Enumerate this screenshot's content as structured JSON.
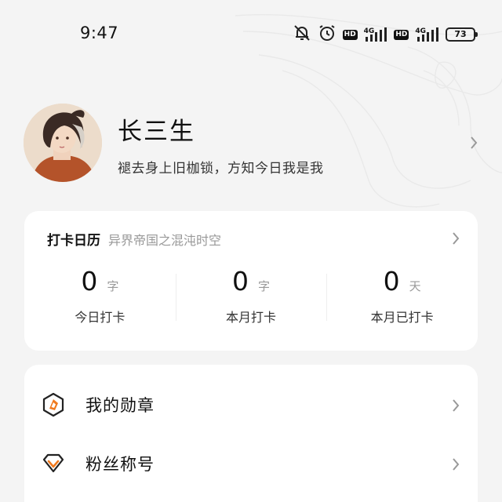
{
  "status_bar": {
    "time": "9:47",
    "hd_1": "HD",
    "net_1": "4G",
    "hd_2": "HD",
    "net_2": "4G",
    "battery": "73",
    "icons": [
      "mute-bell-icon",
      "alarm-icon",
      "signal-icon",
      "battery-icon"
    ]
  },
  "profile": {
    "username": "长三生",
    "bio": "褪去身上旧枷锁，方知今日我是我"
  },
  "checkin": {
    "title": "打卡日历",
    "subtitle": "异界帝国之混沌时空",
    "stats": [
      {
        "value": "0",
        "unit": "字",
        "label": "今日打卡"
      },
      {
        "value": "0",
        "unit": "字",
        "label": "本月打卡"
      },
      {
        "value": "0",
        "unit": "天",
        "label": "本月已打卡"
      }
    ]
  },
  "menu": {
    "items": [
      {
        "label": "我的勋章",
        "icon": "medal-icon"
      },
      {
        "label": "粉丝称号",
        "icon": "diamond-icon"
      }
    ]
  },
  "colors": {
    "accent": "#f07a1e",
    "background": "#f4f4f4",
    "card": "#ffffff",
    "muted_text": "#999999"
  }
}
